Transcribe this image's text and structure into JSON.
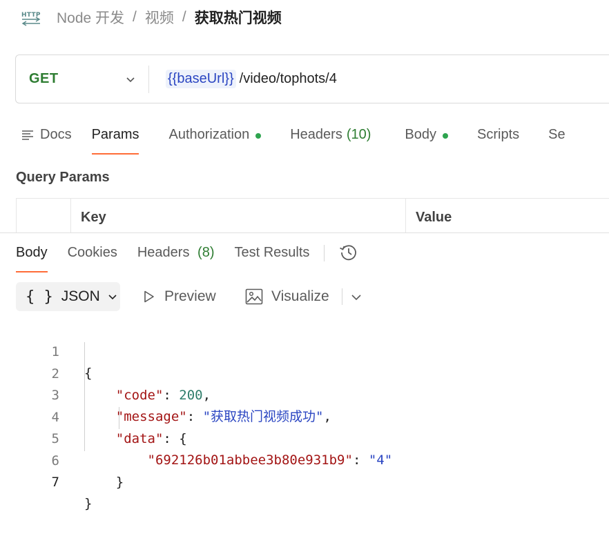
{
  "breadcrumb": {
    "icon": "http-icon",
    "items": [
      "Node 开发",
      "视频"
    ],
    "separator": "/",
    "current": "获取热门视频"
  },
  "request": {
    "method": "GET",
    "url_variable": "{{baseUrl}}",
    "url_path": "/video/tophots/4"
  },
  "request_tabs": {
    "docs": "Docs",
    "params": "Params",
    "authorization": "Authorization",
    "headers": "Headers",
    "headers_count": "(10)",
    "body": "Body",
    "scripts": "Scripts",
    "settings_partial": "Se"
  },
  "query_params": {
    "title": "Query Params",
    "columns": [
      "Key",
      "Value"
    ]
  },
  "response_tabs": {
    "body": "Body",
    "cookies": "Cookies",
    "headers": "Headers",
    "headers_count": "(8)",
    "test_results": "Test Results"
  },
  "format_toolbar": {
    "braces": "{ }",
    "format": "JSON",
    "preview": "Preview",
    "visualize": "Visualize"
  },
  "response_body": {
    "line_numbers": [
      "1",
      "2",
      "3",
      "4",
      "5",
      "6",
      "7"
    ],
    "open_brace": "{",
    "code_key": "\"code\"",
    "code_value": "200",
    "message_key": "\"message\"",
    "message_value": "\"获取热门视频成功\"",
    "data_key": "\"data\"",
    "data_open": "{",
    "entry_key": "\"692126b01abbee3b80e931b9\"",
    "entry_value": "\"4\"",
    "data_close": "}",
    "close_brace": "}"
  },
  "colors": {
    "accent": "#ff6c37",
    "method_get": "#2e7d32",
    "status_dot": "#2ea44f",
    "variable": "#2b46c2",
    "json_key": "#a31515",
    "json_string": "#2b46c2",
    "json_number": "#2e7d6a"
  }
}
